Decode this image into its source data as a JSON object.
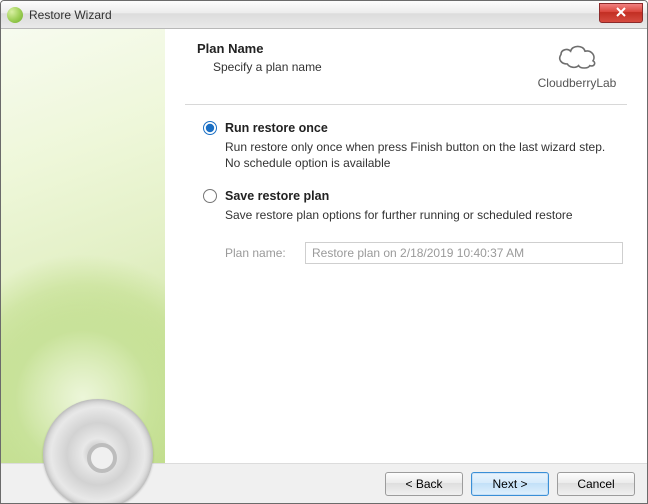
{
  "window": {
    "title": "Restore Wizard"
  },
  "brand": {
    "name": "CloudberryLab"
  },
  "header": {
    "title": "Plan Name",
    "subtitle": "Specify a plan name"
  },
  "options": {
    "run_once": {
      "label": "Run restore once",
      "description": "Run restore only once when press Finish button on the last wizard step. No schedule option is available",
      "selected": true
    },
    "save_plan": {
      "label": "Save restore plan",
      "description": "Save restore plan options for further running or scheduled restore",
      "selected": false
    }
  },
  "plan_field": {
    "label": "Plan name:",
    "value": "Restore plan on 2/18/2019 10:40:37 AM",
    "enabled": false
  },
  "footer": {
    "back": "< Back",
    "next": "Next >",
    "cancel": "Cancel"
  }
}
